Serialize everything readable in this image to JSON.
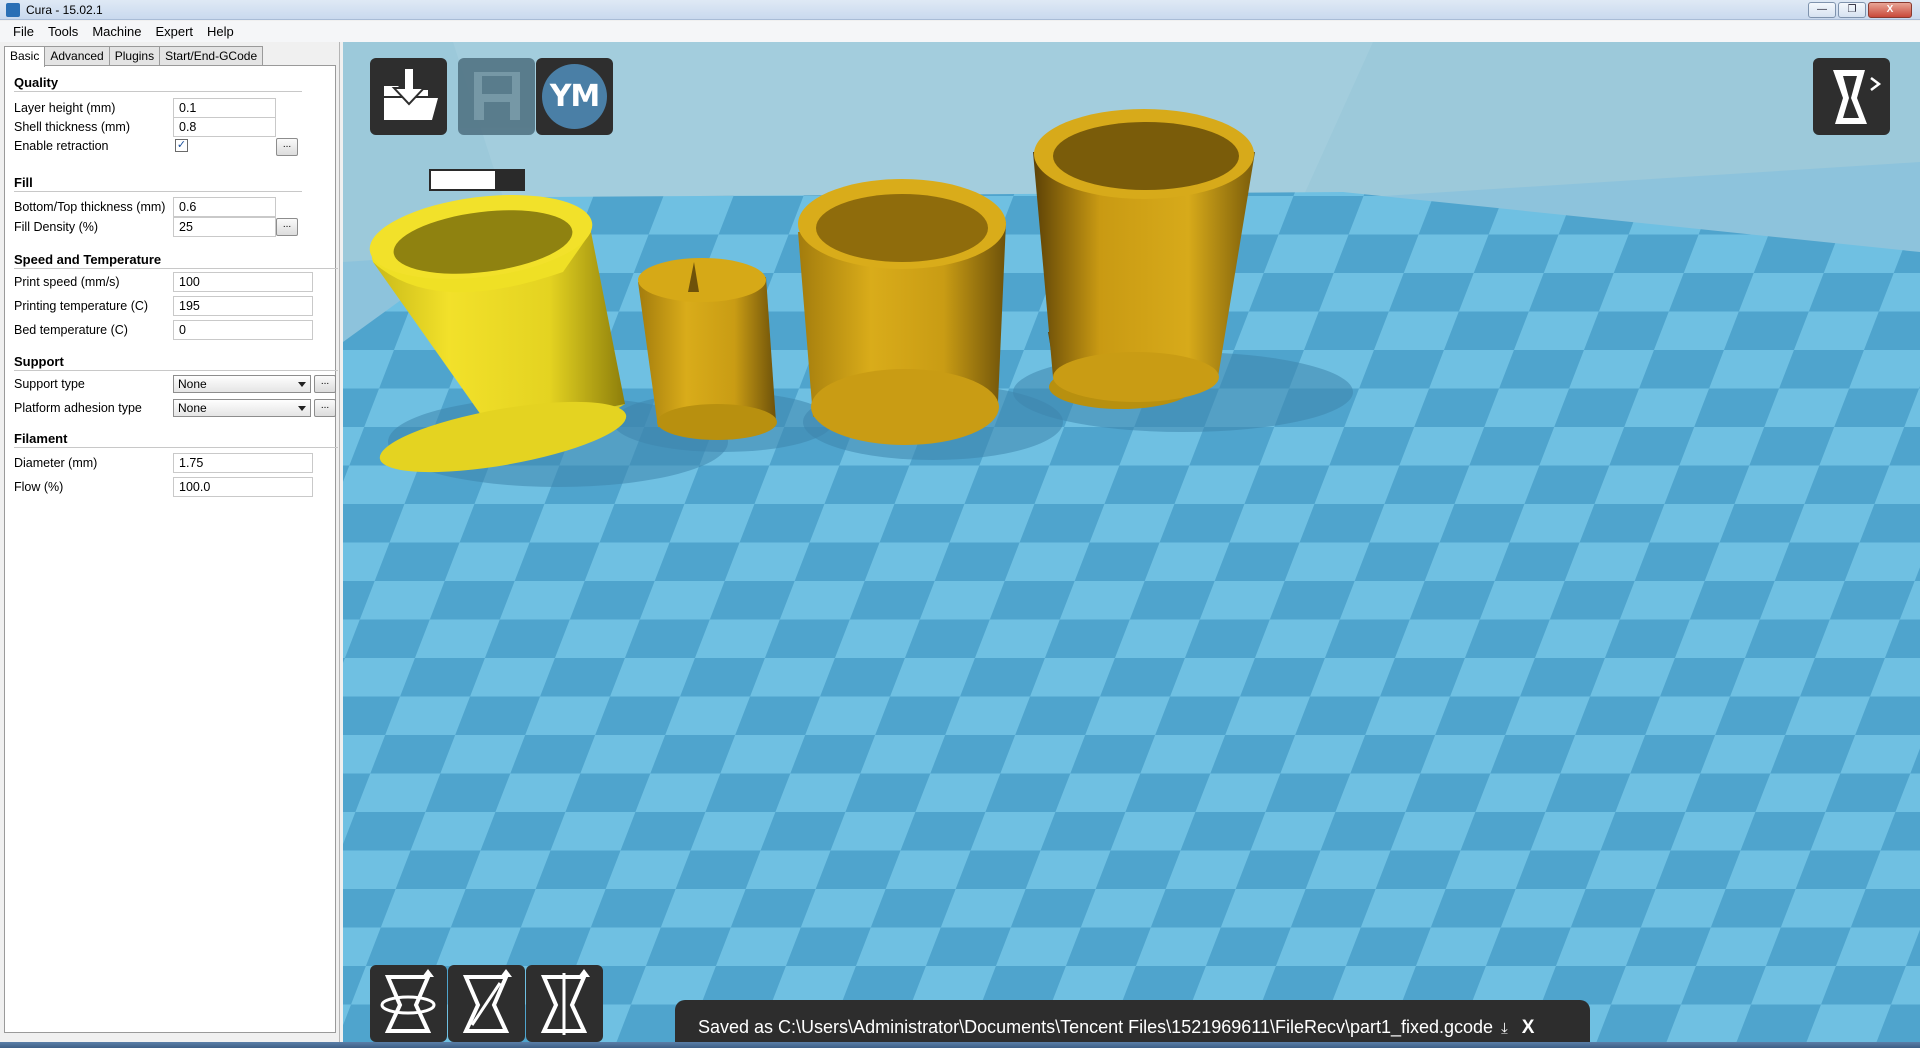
{
  "window": {
    "title": "Cura - 15.02.1",
    "controls": [
      "—",
      "❐",
      "X"
    ]
  },
  "menu": [
    "File",
    "Tools",
    "Machine",
    "Expert",
    "Help"
  ],
  "tabs": [
    "Basic",
    "Advanced",
    "Plugins",
    "Start/End-GCode"
  ],
  "quality": {
    "title": "Quality",
    "layer_height_label": "Layer height (mm)",
    "layer_height": "0.1",
    "shell_thickness_label": "Shell thickness (mm)",
    "shell_thickness": "0.8",
    "retraction_label": "Enable retraction",
    "retraction_checked": "✓"
  },
  "fill": {
    "title": "Fill",
    "bottom_top_label": "Bottom/Top thickness (mm)",
    "bottom_top": "0.6",
    "density_label": "Fill Density (%)",
    "density": "25"
  },
  "speed": {
    "title": "Speed and Temperature",
    "print_speed_label": "Print speed (mm/s)",
    "print_speed": "100",
    "print_temp_label": "Printing temperature (C)",
    "print_temp": "195",
    "bed_temp_label": "Bed temperature (C)",
    "bed_temp": "0"
  },
  "support": {
    "title": "Support",
    "type_label": "Support type",
    "type": "None",
    "adhesion_label": "Platform adhesion type",
    "adhesion": "None"
  },
  "filament": {
    "title": "Filament",
    "diameter_label": "Diameter (mm)",
    "diameter": "1.75",
    "flow_label": "Flow (%)",
    "flow": "100.0"
  },
  "dots_label": "...",
  "toolbar": {
    "ym_label": "YM",
    "progress_fraction": 0.7
  },
  "notification": {
    "text": "Saved as C:\\Users\\Administrator\\Documents\\Tencent Files\\1521969611\\FileRecv\\part1_fixed.gcode",
    "save_glyph": "⤓",
    "close": "X"
  },
  "colors": {
    "viewport_bg": "#8dc3dc",
    "floor_light": "#6fc0e2",
    "floor_dark": "#4fa4cd",
    "model_selected": "#f2e12a",
    "model": "#d9ac1a"
  }
}
